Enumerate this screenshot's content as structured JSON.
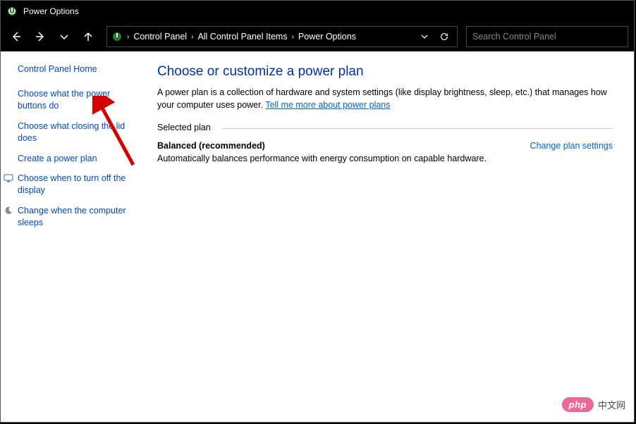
{
  "title": "Power Options",
  "breadcrumb": {
    "items": [
      "Control Panel",
      "All Control Panel Items",
      "Power Options"
    ]
  },
  "search": {
    "placeholder": "Search Control Panel"
  },
  "sidebar": {
    "home": "Control Panel Home",
    "links": [
      {
        "label": "Choose what the power buttons do"
      },
      {
        "label": "Choose what closing the lid does"
      },
      {
        "label": "Create a power plan"
      },
      {
        "label": "Choose when to turn off the display"
      },
      {
        "label": "Change when the computer sleeps"
      }
    ]
  },
  "main": {
    "heading": "Choose or customize a power plan",
    "desc_prefix": "A power plan is a collection of hardware and system settings (like display brightness, sleep, etc.) that manages how your computer uses power. ",
    "desc_link": "Tell me more about power plans",
    "section_label": "Selected plan",
    "plan_name": "Balanced (recommended)",
    "change_link": "Change plan settings",
    "plan_desc": "Automatically balances performance with energy consumption on capable hardware."
  },
  "watermark": {
    "badge": "php",
    "text": "中文网"
  }
}
